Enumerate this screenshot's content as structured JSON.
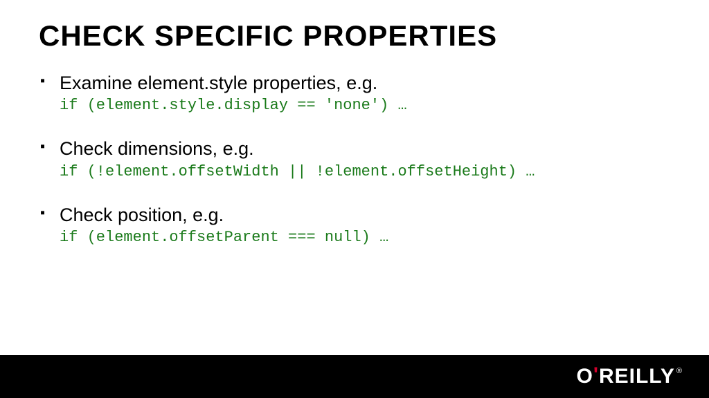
{
  "slide": {
    "title": "CHECK SPECIFIC PROPERTIES",
    "bullets": [
      {
        "text": "Examine element.style properties, e.g.",
        "code": "if (element.style.display == 'none') …"
      },
      {
        "text": "Check dimensions, e.g.",
        "code": "if (!element.offsetWidth || !element.offsetHeight) …"
      },
      {
        "text": "Check position, e.g.",
        "code": "if (element.offsetParent === null) …"
      }
    ]
  },
  "footer": {
    "brand_prefix": "O",
    "brand_apostrophe": "'",
    "brand_suffix": "REILLY",
    "brand_reg": "®"
  }
}
